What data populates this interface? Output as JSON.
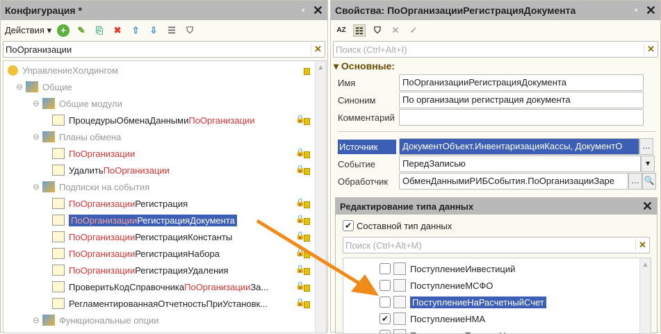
{
  "left": {
    "title": "Конфигурация *",
    "pin": "ᵍ",
    "actions": "Действия",
    "search_value": "ПоОрганизации",
    "tree": [
      {
        "parts": [
          {
            "t": "УправлениеХолдингом",
            "c": "gray"
          }
        ],
        "level": 0,
        "exp": ""
      },
      {
        "parts": [
          {
            "t": "Общие",
            "c": "gray"
          }
        ],
        "level": 1,
        "exp": "⊖"
      },
      {
        "parts": [
          {
            "t": "Общие модули",
            "c": "gray"
          }
        ],
        "level": 2,
        "exp": "⊖"
      },
      {
        "parts": [
          {
            "t": "ПроцедурыОбменаДанными",
            "c": ""
          },
          {
            "t": "ПоОрганизации",
            "c": "red"
          }
        ],
        "level": 3,
        "exp": ""
      },
      {
        "parts": [
          {
            "t": "Планы обмена",
            "c": "gray"
          }
        ],
        "level": 2,
        "exp": "⊖"
      },
      {
        "parts": [
          {
            "t": "ПоОрганизации",
            "c": "red"
          }
        ],
        "level": 3,
        "exp": ""
      },
      {
        "parts": [
          {
            "t": "Удалить",
            "c": ""
          },
          {
            "t": "ПоОрганизации",
            "c": "red"
          }
        ],
        "level": 3,
        "exp": ""
      },
      {
        "parts": [
          {
            "t": "Подписки на события",
            "c": "gray"
          }
        ],
        "level": 2,
        "exp": "⊖"
      },
      {
        "parts": [
          {
            "t": "ПоОрганизации",
            "c": "red"
          },
          {
            "t": "Регистрация",
            "c": ""
          }
        ],
        "level": 3,
        "exp": ""
      },
      {
        "parts": [
          {
            "t": "ПоОрганизации",
            "c": "red"
          },
          {
            "t": "РегистрацияДокумента",
            "c": ""
          }
        ],
        "level": 3,
        "exp": "",
        "selected": true
      },
      {
        "parts": [
          {
            "t": "ПоОрганизации",
            "c": "red"
          },
          {
            "t": "РегистрацияКонстанты",
            "c": ""
          }
        ],
        "level": 3,
        "exp": ""
      },
      {
        "parts": [
          {
            "t": "ПоОрганизации",
            "c": "red"
          },
          {
            "t": "РегистрацияНабора",
            "c": ""
          }
        ],
        "level": 3,
        "exp": ""
      },
      {
        "parts": [
          {
            "t": "ПоОрганизации",
            "c": "red"
          },
          {
            "t": "РегистрацияУдаления",
            "c": ""
          }
        ],
        "level": 3,
        "exp": ""
      },
      {
        "parts": [
          {
            "t": "ПроверитьКодСправочника",
            "c": ""
          },
          {
            "t": "ПоОрганизации",
            "c": "red"
          },
          {
            "t": "За...",
            "c": ""
          }
        ],
        "level": 3,
        "exp": ""
      },
      {
        "parts": [
          {
            "t": "РегламентированнаяОтчетностьПриУстановк...",
            "c": ""
          }
        ],
        "level": 3,
        "exp": ""
      },
      {
        "parts": [
          {
            "t": "Функциональные опции",
            "c": "gray"
          }
        ],
        "level": 2,
        "exp": "⊖"
      }
    ]
  },
  "right": {
    "title": "Свойства: ПоОрганизацииРегистрацияДокумента",
    "search_placeholder": "Поиск (Ctrl+Alt+I)",
    "section": "Основные:",
    "props": [
      {
        "label": "Имя",
        "value": "ПоОрганизацииРегистрацияДокумента"
      },
      {
        "label": "Синоним",
        "value": "По организации регистрация документа"
      },
      {
        "label": "Комментарий",
        "value": ""
      },
      {
        "label": "Источник",
        "value": "ДокументОбъект.ИнвентаризацияКассы, ДокументО"
      },
      {
        "label": "Событие",
        "value": "ПередЗаписью"
      },
      {
        "label": "Обработчик",
        "value": "ОбменДаннымиРИБСобытия.ПоОрганизацииЗаре"
      }
    ],
    "type_editor": {
      "title": "Редактирование типа данных",
      "composite_label": "Составной тип данных",
      "search_placeholder": "Поиск (Ctrl+Alt+M)",
      "items": [
        {
          "label": "ПоступлениеИнвестиций",
          "checked": false
        },
        {
          "label": "ПоступлениеМСФО",
          "checked": false
        },
        {
          "label": "ПоступлениеНаРасчетныйСчет",
          "checked": false,
          "selected": true
        },
        {
          "label": "ПоступлениеНМА",
          "checked": true
        },
        {
          "label": "ПоступлениеТоваровУ...",
          "checked": true
        }
      ]
    }
  },
  "colors": {
    "accent": "#3c5fb5",
    "arrow": "#f28a1a",
    "red": "#d33"
  }
}
